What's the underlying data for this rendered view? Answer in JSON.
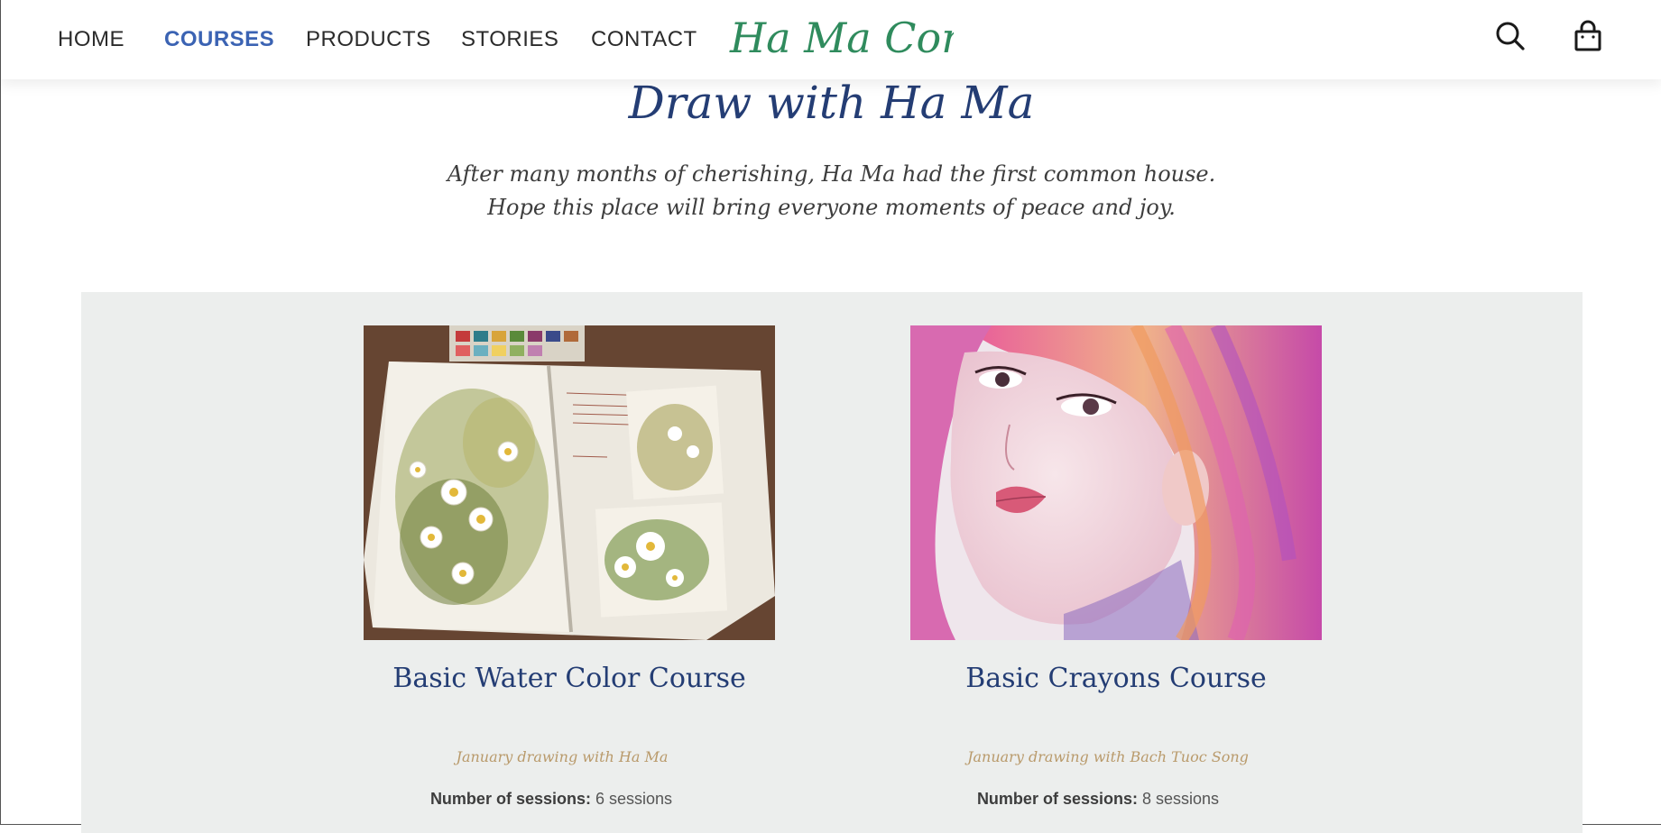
{
  "nav": {
    "links": [
      {
        "label": "HOME",
        "active": false
      },
      {
        "label": "COURSES",
        "active": true
      },
      {
        "label": "PRODUCTS",
        "active": false
      },
      {
        "label": "STORIES",
        "active": false
      },
      {
        "label": "CONTACT",
        "active": false
      }
    ],
    "logo_text": "Ha Ma Corner",
    "icons": [
      "search-icon",
      "shopping-bag-icon"
    ]
  },
  "hero": {
    "title": "Draw with Ha Ma",
    "subtitle_line1": "After many months of cherishing, Ha Ma had the first common house.",
    "subtitle_line2": "Hope this place will bring everyone moments of peace and joy."
  },
  "courses": [
    {
      "title": "Basic Water Color Course",
      "teacher": "January drawing with Ha Ma",
      "sessions_label": "Number of sessions:",
      "sessions_value": "6 sessions",
      "image": "watercolor-daisies-sketchbook"
    },
    {
      "title": "Basic Crayons Course",
      "teacher": "January drawing with Bach Tuoc Song",
      "sessions_label": "Number of sessions:",
      "sessions_value": "8 sessions",
      "image": "crayon-portrait-pink-hair"
    }
  ],
  "colors": {
    "primary": "#243d74",
    "active_nav": "#3b63b3",
    "logo_green": "#2f8b5d",
    "accent_gold": "#b99a6b",
    "panel_bg": "#eceeed"
  }
}
